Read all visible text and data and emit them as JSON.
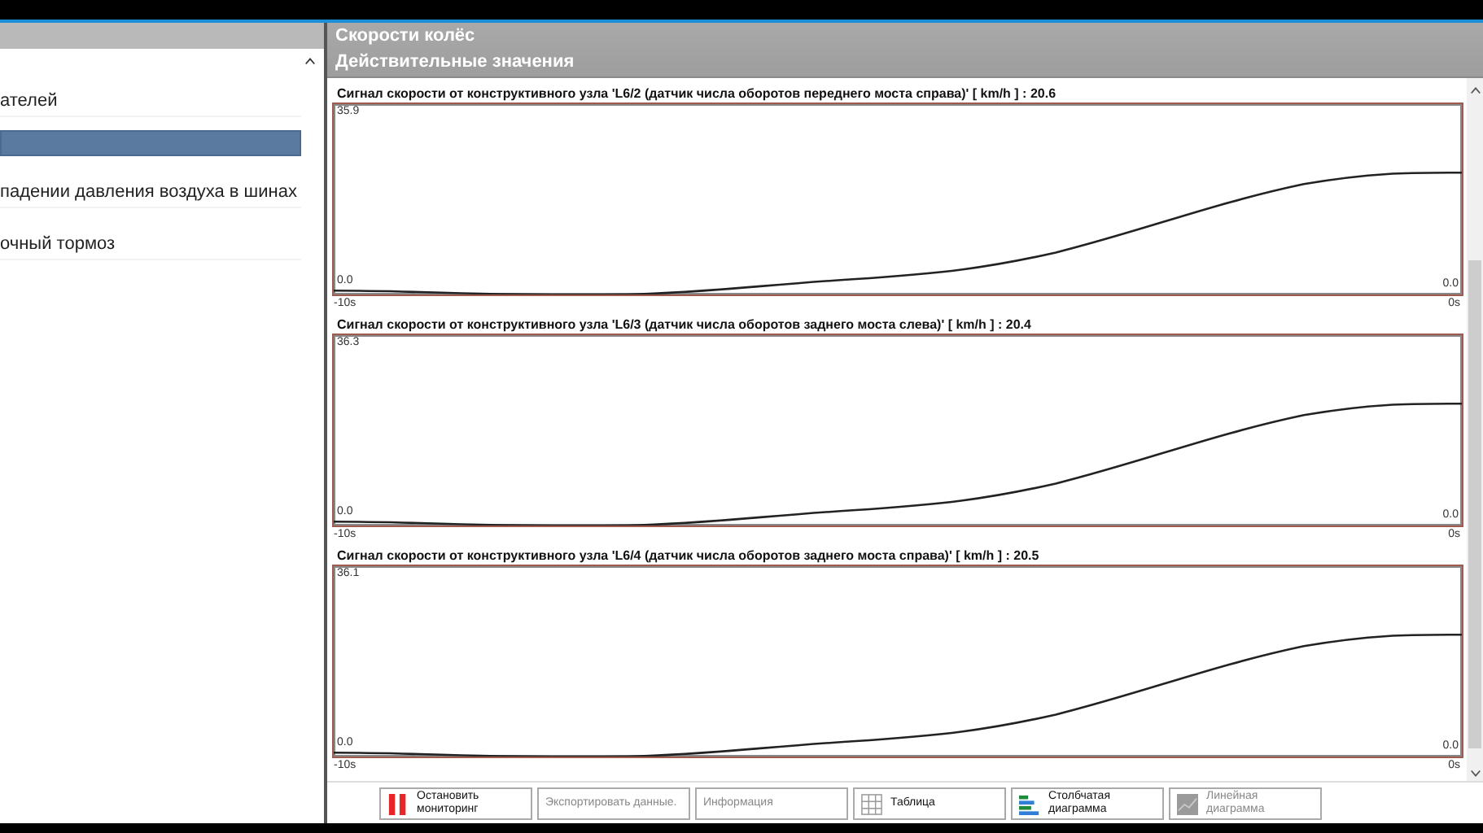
{
  "sidebar": {
    "items": [
      {
        "label": "ателей",
        "selected": false
      },
      {
        "selected": true
      },
      {
        "label": "падении давления воздуха в шинах",
        "selected": false
      },
      {
        "label": "очный тормоз",
        "selected": false
      }
    ]
  },
  "header": {
    "title": "Скорости колёс",
    "subtitle": "Действительные значения"
  },
  "charts": [
    {
      "title": "Сигнал скорости от конструктивного узла 'L6/2 (датчик числа оборотов переднего моста справа)' [ km/h ] : 20.6",
      "y_max": "35.9",
      "y_min": "0.0",
      "right_min": "0.0",
      "x_start": "-10s",
      "x_end": "0s"
    },
    {
      "title": "Сигнал скорости от конструктивного узла 'L6/3 (датчик числа оборотов заднего моста слева)' [ km/h ] : 20.4",
      "y_max": "36.3",
      "y_min": "0.0",
      "right_min": "0.0",
      "x_start": "-10s",
      "x_end": "0s"
    },
    {
      "title": "Сигнал скорости от конструктивного узла 'L6/4 (датчик числа оборотов заднего моста справа)' [ km/h ] : 20.5",
      "y_max": "36.1",
      "y_min": "0.0",
      "right_min": "0.0",
      "x_start": "-10s",
      "x_end": "0s"
    }
  ],
  "buttons": [
    {
      "kind": "stop",
      "label": "Остановить мониторинг",
      "disabled": false
    },
    {
      "kind": "plain",
      "label": "Экспортировать данные.",
      "disabled": true
    },
    {
      "kind": "plain",
      "label": "Информация",
      "disabled": true
    },
    {
      "kind": "table",
      "label": "Таблица",
      "disabled": false
    },
    {
      "kind": "bar",
      "label": "Столбчатая диаграмма",
      "disabled": false
    },
    {
      "kind": "line",
      "label": "Линейная диаграмма",
      "disabled": true
    }
  ]
}
